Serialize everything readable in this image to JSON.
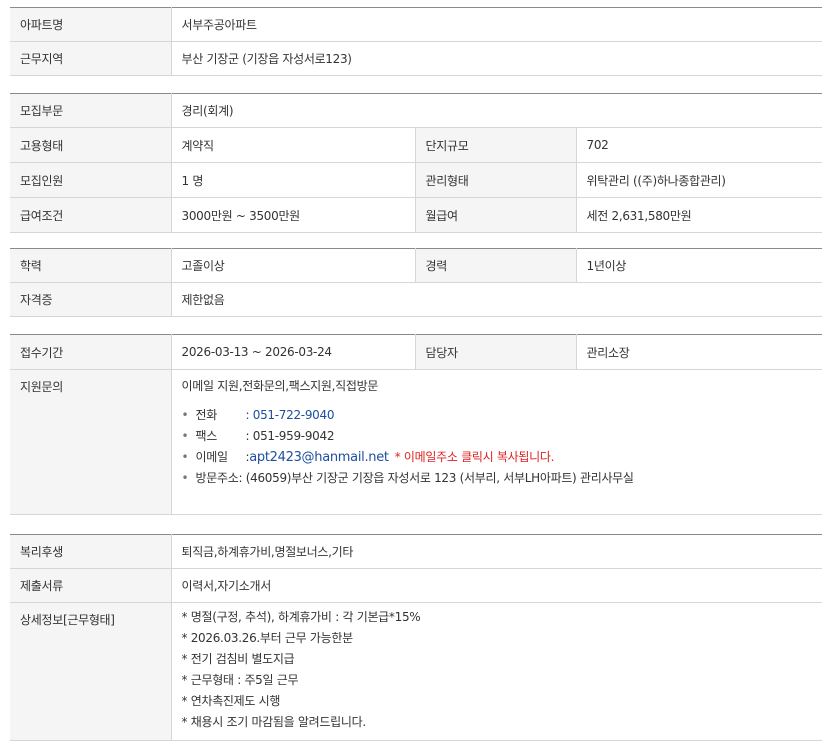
{
  "basic": {
    "apt_name_label": "아파트명",
    "apt_name": "서부주공아파트",
    "region_label": "근무지역",
    "region": "부산 기장군 (기장읍 자성서로123)"
  },
  "job": {
    "dept_label": "모집부문",
    "dept": "경리(회계)",
    "emp_type_label": "고용형태",
    "emp_type": "계약직",
    "scale_label": "단지규모",
    "scale": "702",
    "headcount_label": "모집인원",
    "headcount": "1 명",
    "mgmt_type_label": "관리형태",
    "mgmt_type": "위탁관리 ((주)하나종합관리)",
    "salary_cond_label": "급여조건",
    "salary_cond": "3000만원 ~ 3500만원",
    "monthly_label": "월급여",
    "monthly": "세전 2,631,580만원"
  },
  "qual": {
    "edu_label": "학력",
    "edu": "고졸이상",
    "career_label": "경력",
    "career": "1년이상",
    "license_label": "자격증",
    "license": "제한없음"
  },
  "apply": {
    "period_label": "접수기간",
    "period": "2026-03-13 ~ 2026-03-24",
    "manager_label": "담당자",
    "manager": "관리소장",
    "inquiry_label": "지원문의",
    "methods": "이메일 지원,전화문의,팩스지원,직접방문",
    "bullet": "•",
    "phone_label": "전화",
    "phone": ": 051-722-9040",
    "fax_label": "팩스",
    "fax": ": 051-959-9042",
    "email_label": "이메일",
    "email_prefix": ":",
    "email": "apt2423@hanmail.net",
    "email_notice": "* 이메일주소 클릭시 복사됩니다.",
    "address_label": "방문주소",
    "address": ": (46059)부산 기장군 기장읍 자성서로 123 (서부리, 서부LH아파트) 관리사무실"
  },
  "etc": {
    "welfare_label": "복리후생",
    "welfare": "퇴직금,하계휴가비,명절보너스,기타",
    "docs_label": "제출서류",
    "docs": "이력서,자기소개서",
    "detail_label": "상세정보[근무형태]",
    "details": [
      "* 명절(구정, 추석), 하계휴가비 : 각 기본급*15%",
      "* 2026.03.26.부터 근무 가능한분",
      "* 전기 검침비 별도지급",
      "* 근무형태 : 주5일 근무",
      "* 연차촉진제도 시행",
      "* 채용시 조기 마감됨을 알려드립니다."
    ]
  }
}
